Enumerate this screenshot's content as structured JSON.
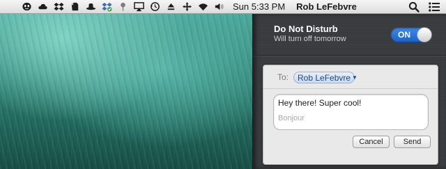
{
  "menubar": {
    "status_icons": [
      "alien-icon",
      "cloud-icon",
      "dropbox-icon",
      "evernote-icon",
      "hat-icon",
      "dropbox-sync-icon",
      "pin-icon",
      "airplay-icon",
      "time-machine-icon",
      "eject-icon",
      "move-icon",
      "wifi-icon",
      "volume-icon"
    ],
    "clock": "Sun 5:33 PM",
    "user_name": "Rob LeFebvre"
  },
  "notification_center": {
    "do_not_disturb": {
      "title": "Do Not Disturb",
      "subtitle": "Will turn off tomorrow",
      "toggle_label": "ON",
      "toggle_state": "on",
      "toggle_color": "#2a74dc"
    },
    "share_card": {
      "to_label": "To:",
      "recipient": "Rob LeFebvre",
      "message_text": "Hey there! Super cool!",
      "message_placeholder": "Bonjour",
      "cancel_label": "Cancel",
      "send_label": "Send"
    }
  }
}
